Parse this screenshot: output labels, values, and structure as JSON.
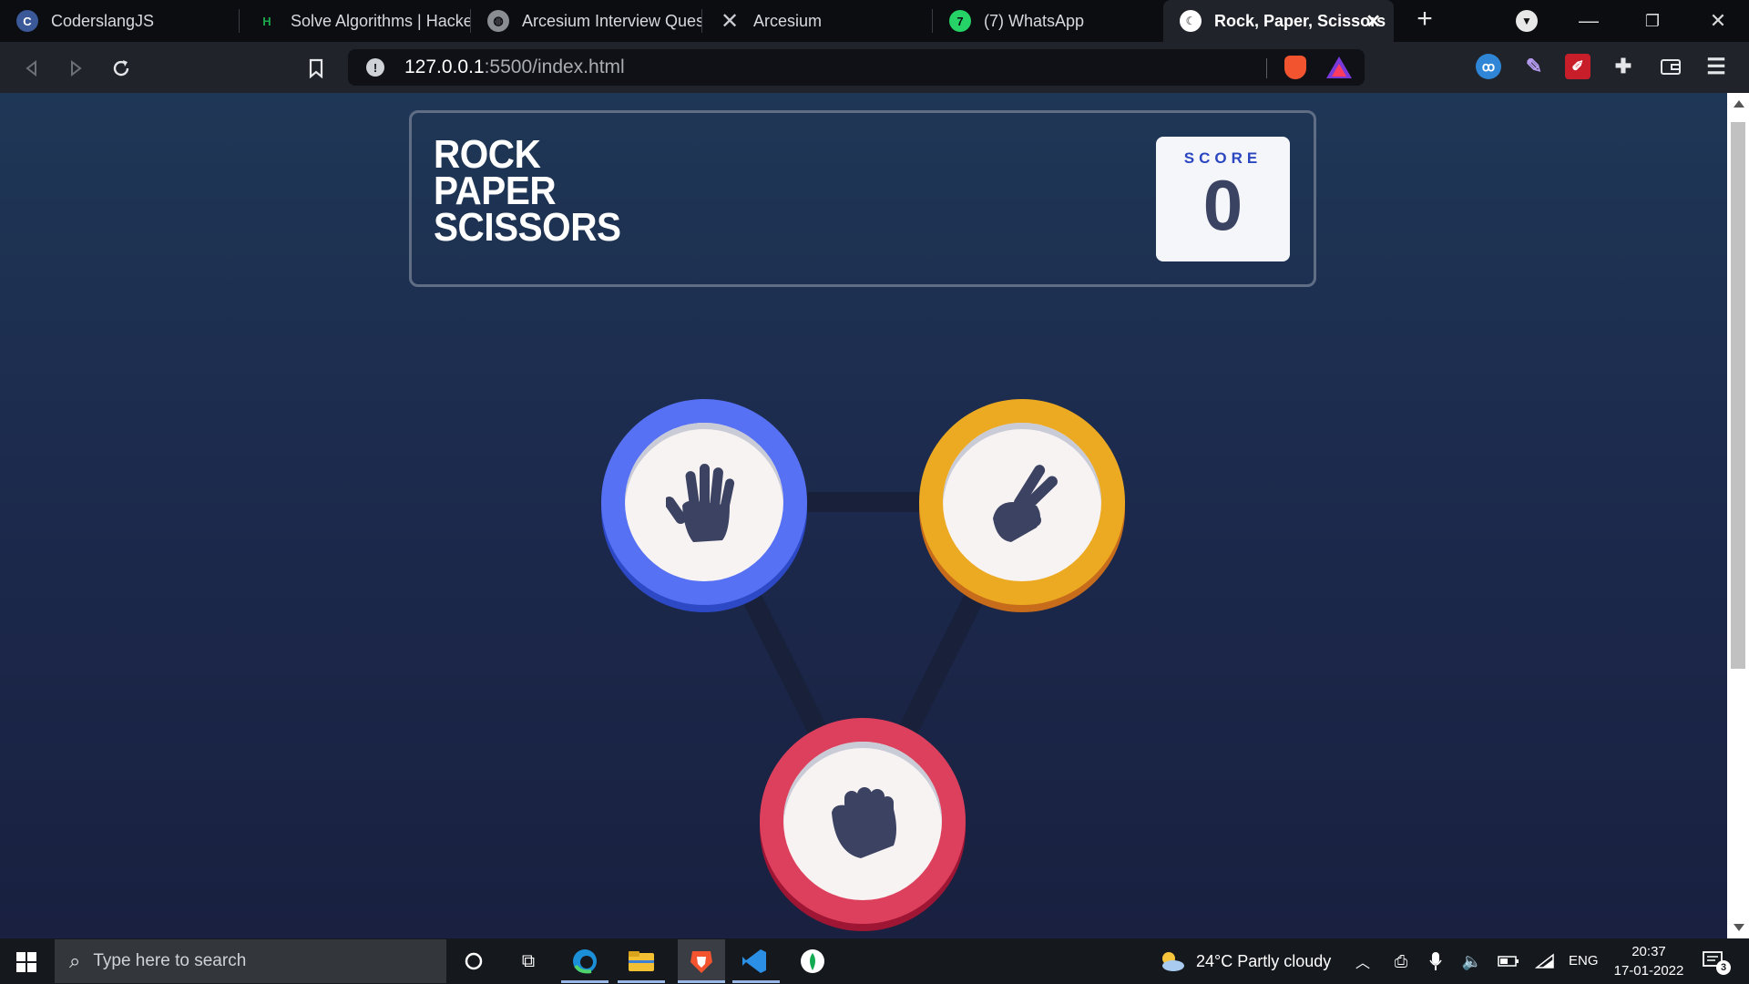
{
  "browser": {
    "tabs": [
      {
        "label": "CoderslangJS",
        "icon": "coderslang-icon",
        "color": "#3b5998"
      },
      {
        "label": "Solve Algorithms | HackerRank",
        "icon": "hackerrank-icon",
        "color": "#1ba94c"
      },
      {
        "label": "Arcesium Interview Questions",
        "icon": "globe-icon",
        "color": "#8a8d92"
      },
      {
        "label": "Arcesium",
        "icon": "arcesium-x-icon",
        "color": "#c9ccd2"
      },
      {
        "label": "(7) WhatsApp",
        "icon": "whatsapp-icon",
        "color": "#25d366",
        "badge": "7"
      },
      {
        "label": "Rock, Paper, Scissors",
        "icon": "page-icon",
        "color": "#ffffff",
        "active": true
      }
    ],
    "url_host": "127.0.0.1",
    "url_path": ":5500/index.html"
  },
  "game": {
    "title_lines": [
      "ROCK",
      "PAPER",
      "SCISSORS"
    ],
    "score_label": "SCORE",
    "score_value": "0",
    "choices": [
      {
        "name": "paper",
        "color": "#5771f4",
        "icon": "hand-paper-icon"
      },
      {
        "name": "scissors",
        "color": "#eca922",
        "icon": "hand-scissors-icon"
      },
      {
        "name": "rock",
        "color": "#dd405d",
        "icon": "hand-rock-icon"
      }
    ]
  },
  "taskbar": {
    "search_placeholder": "Type here to search",
    "weather": "24°C  Partly cloudy",
    "language": "ENG",
    "time": "20:37",
    "date": "17-01-2022",
    "notifications": "3"
  }
}
